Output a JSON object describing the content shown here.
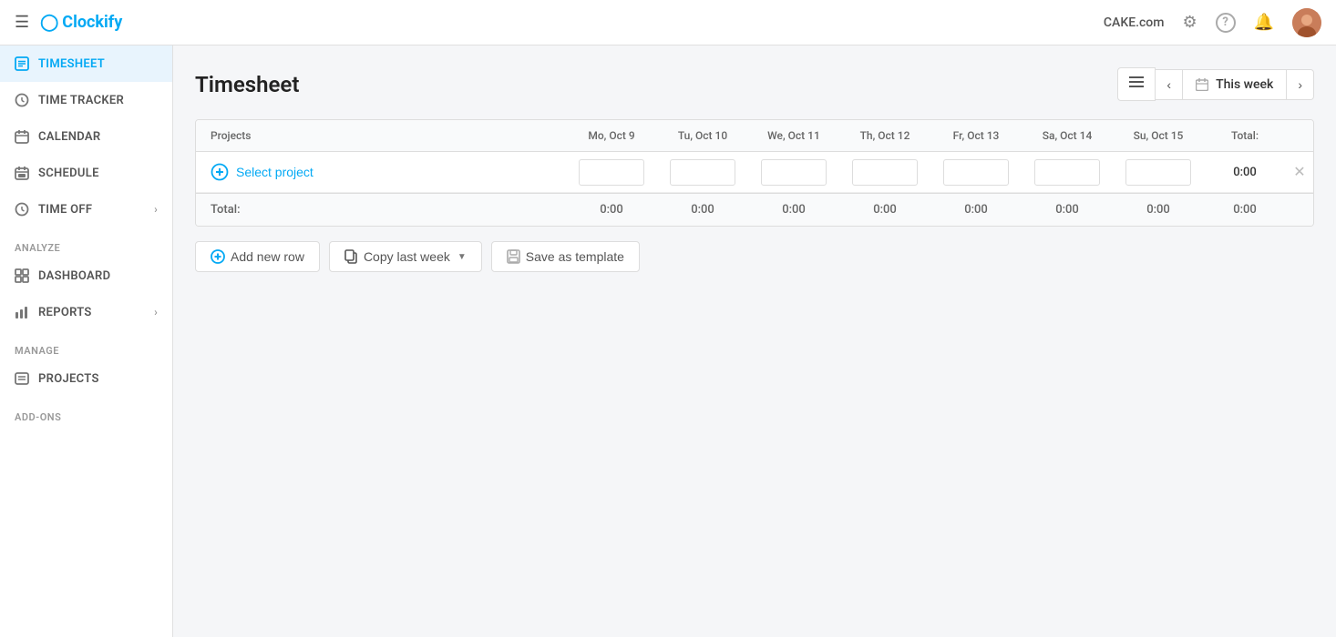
{
  "topbar": {
    "menu_icon": "☰",
    "logo_text": "Clockify",
    "company_name": "CAKE.com",
    "puzzle_icon": "🧩",
    "help_icon": "?",
    "bell_icon": "🔔"
  },
  "sidebar": {
    "section_items": [
      {
        "id": "timesheet",
        "label": "TIMESHEET",
        "icon": "📋",
        "active": true
      },
      {
        "id": "time-tracker",
        "label": "TIME TRACKER",
        "icon": "⏱"
      },
      {
        "id": "calendar",
        "label": "CALENDAR",
        "icon": "📅"
      },
      {
        "id": "schedule",
        "label": "SCHEDULE",
        "icon": "📆"
      },
      {
        "id": "time-off",
        "label": "TIME OFF",
        "icon": "🏖",
        "has_chevron": true
      }
    ],
    "analyze_label": "ANALYZE",
    "analyze_items": [
      {
        "id": "dashboard",
        "label": "DASHBOARD",
        "icon": "⊞"
      },
      {
        "id": "reports",
        "label": "REPORTS",
        "icon": "📊",
        "has_chevron": true
      }
    ],
    "manage_label": "MANAGE",
    "manage_items": [
      {
        "id": "projects",
        "label": "PROJECTS",
        "icon": "📄"
      }
    ],
    "addons_label": "ADD-ONS"
  },
  "page": {
    "title": "Timesheet",
    "week_label": "This week"
  },
  "table": {
    "columns": [
      "Projects",
      "Mo, Oct 9",
      "Tu, Oct 10",
      "We, Oct 11",
      "Th, Oct 12",
      "Fr, Oct 13",
      "Sa, Oct 14",
      "Su, Oct 15",
      "Total:"
    ],
    "select_project_label": "Select project",
    "row_total": "0:00",
    "totals_label": "Total:",
    "totals": [
      "0:00",
      "0:00",
      "0:00",
      "0:00",
      "0:00",
      "0:00",
      "0:00",
      "0:00"
    ]
  },
  "actions": {
    "add_row": "Add new row",
    "copy_last_week": "Copy last week",
    "save_as_template": "Save as template"
  }
}
